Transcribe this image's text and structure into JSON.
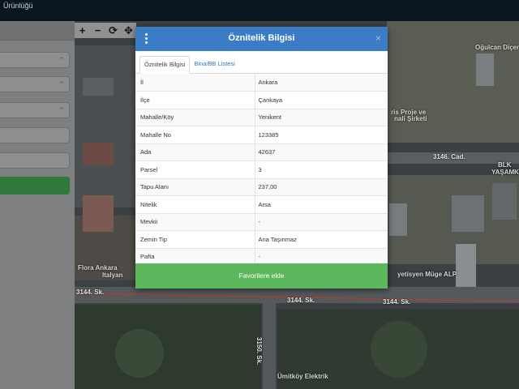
{
  "topbar": {
    "title": "Ürünlüğü"
  },
  "map": {
    "tools": [
      "+",
      "−",
      "⟳",
      "✥"
    ],
    "labels": [
      "Oğulcan Diçen",
      "ris Proje ve",
      "nali Şirketi",
      "3146. Cad.",
      "BLK",
      "YAŞAMK",
      "Flora Ankara",
      "Italyan",
      "yetisyen Müge ALP",
      "3144. Sk.",
      "3144. Sk.",
      "3144. Sk.",
      "3150. Sk.",
      "Ümitköy Elektrik"
    ]
  },
  "modal": {
    "title": "Öznitelik Bilgisi",
    "tabs": [
      {
        "label": "Öznitelik Bilgisi",
        "active": true
      },
      {
        "label": "Bina/BB Listesi",
        "active": false
      }
    ],
    "rows": [
      {
        "label": "İl",
        "value": "Ankara"
      },
      {
        "label": "İlçe",
        "value": "Çankaya"
      },
      {
        "label": "Mahalle/Köy",
        "value": "Yenikent"
      },
      {
        "label": "Mahalle No",
        "value": "123385"
      },
      {
        "label": "Ada",
        "value": "42637"
      },
      {
        "label": "Parsel",
        "value": "3"
      },
      {
        "label": "Tapu Alanı",
        "value": "237,00"
      },
      {
        "label": "Nitelik",
        "value": "Arsa"
      },
      {
        "label": "Mevkii",
        "value": "-"
      },
      {
        "label": "Zemin Tip",
        "value": "Ana Taşınmaz"
      },
      {
        "label": "Pafta",
        "value": "-"
      }
    ],
    "favorite_label": "Favorilere ekle",
    "close_label": "×"
  },
  "colors": {
    "header": "#3a7cc6",
    "favorite": "#5cb85c",
    "tab_link": "#337ab7"
  }
}
